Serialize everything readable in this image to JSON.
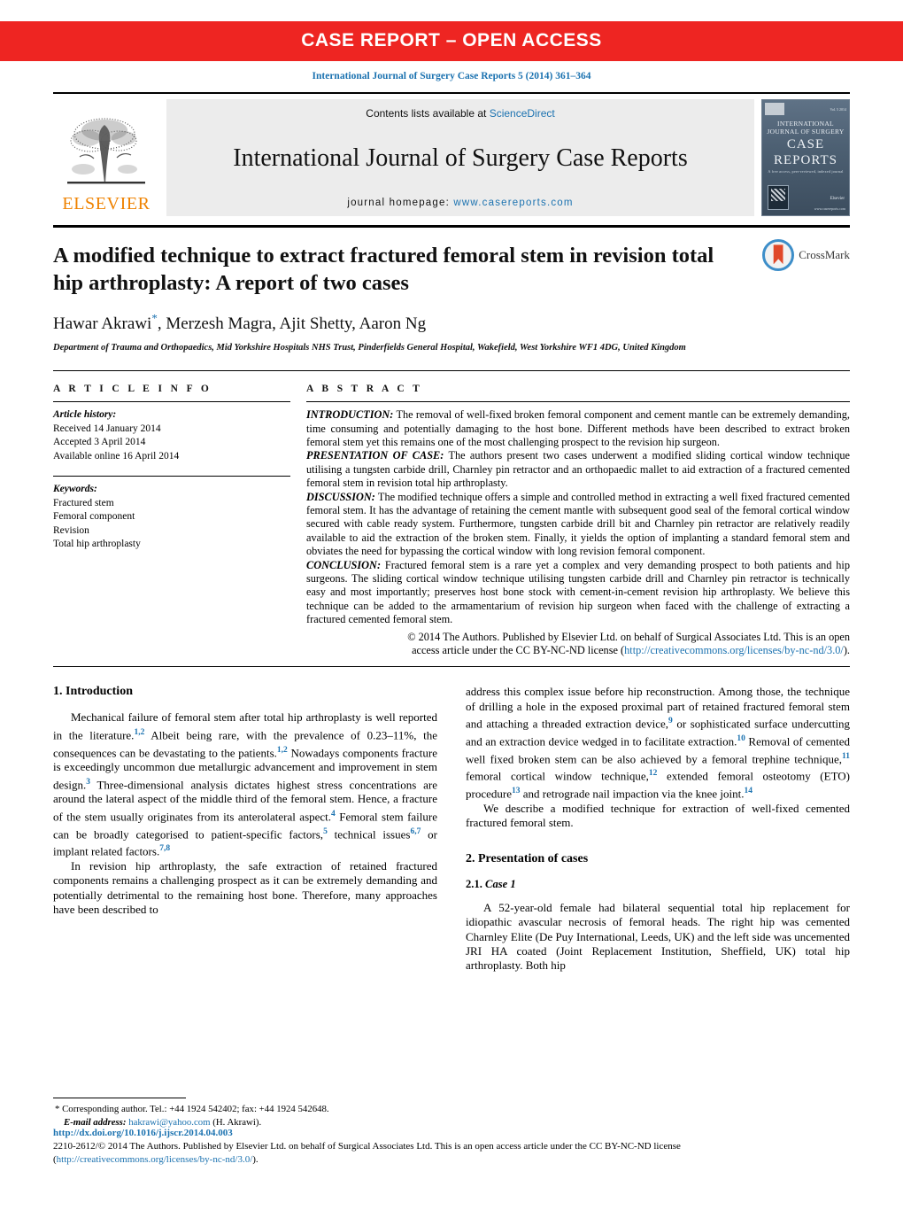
{
  "banner": {
    "text": "CASE REPORT – OPEN ACCESS"
  },
  "journal_ref": "International Journal of Surgery Case Reports 5 (2014) 361–364",
  "masthead": {
    "publisher_name": "ELSEVIER",
    "contents_prefix": "Contents lists available at ",
    "contents_link": "ScienceDirect",
    "journal_title": "International Journal of Surgery Case Reports",
    "homepage_prefix": "journal homepage: ",
    "homepage_url": "www.casereports.com",
    "cover": {
      "line1": "INTERNATIONAL JOURNAL OF SURGERY",
      "line2a": "CASE",
      "line2b": "REPORTS",
      "line3": "A free access, peer-reviewed, indexed journal",
      "brand": "Elsevier",
      "url": "www.casereports.com"
    }
  },
  "article": {
    "title": "A modified technique to extract fractured femoral stem in revision total hip arthroplasty: A report of two cases",
    "authors": "Hawar Akrawi, Merzesh Magra, Ajit Shetty, Aaron Ng",
    "corresponding_marker": "*",
    "affiliation": "Department of Trauma and Orthopaedics, Mid Yorkshire Hospitals NHS Trust, Pinderfields General Hospital, Wakefield, West Yorkshire WF1 4DG, United Kingdom",
    "crossmark_label": "CrossMark"
  },
  "article_info": {
    "heading": "A R T I C L E  I N F O",
    "history_label": "Article history:",
    "history": [
      "Received 14 January 2014",
      "Accepted 3 April 2014",
      "Available online 16 April 2014"
    ],
    "keywords_label": "Keywords:",
    "keywords": [
      "Fractured stem",
      "Femoral component",
      "Revision",
      "Total hip arthroplasty"
    ]
  },
  "abstract": {
    "heading": "A B S T R A C T",
    "sections": [
      {
        "label": "INTRODUCTION:",
        "text": " The removal of well-fixed broken femoral component and cement mantle can be extremely demanding, time consuming and potentially damaging to the host bone. Different methods have been described to extract broken femoral stem yet this remains one of the most challenging prospect to the revision hip surgeon."
      },
      {
        "label": "PRESENTATION OF CASE:",
        "text": " The authors present two cases underwent a modified sliding cortical window technique utilising a tungsten carbide drill, Charnley pin retractor and an orthopaedic mallet to aid extraction of a fractured cemented femoral stem in revision total hip arthroplasty."
      },
      {
        "label": "DISCUSSION:",
        "text": " The modified technique offers a simple and controlled method in extracting a well fixed fractured cemented femoral stem. It has the advantage of retaining the cement mantle with subsequent good seal of the femoral cortical window secured with cable ready system. Furthermore, tungsten carbide drill bit and Charnley pin retractor are relatively readily available to aid the extraction of the broken stem. Finally, it yields the option of implanting a standard femoral stem and obviates the need for bypassing the cortical window with long revision femoral component."
      },
      {
        "label": "CONCLUSION:",
        "text": " Fractured femoral stem is a rare yet a complex and very demanding prospect to both patients and hip surgeons. The sliding cortical window technique utilising tungsten carbide drill and Charnley pin retractor is technically easy and most importantly; preserves host bone stock with cement-in-cement revision hip arthroplasty. We believe this technique can be added to the armamentarium of revision hip surgeon when faced with the challenge of extracting a fractured cemented femoral stem."
      }
    ],
    "copyright_line1": "© 2014 The Authors. Published by Elsevier Ltd. on behalf of Surgical Associates Ltd. This is an open",
    "copyright_line2_prefix": "access article under the CC BY-NC-ND license (",
    "copyright_link": "http://creativecommons.org/licenses/by-nc-nd/3.0/",
    "copyright_line2_suffix": ")."
  },
  "body": {
    "left": {
      "section1_heading": "1.  Introduction",
      "para1_a": "Mechanical failure of femoral stem after total hip arthroplasty is well reported in the literature.",
      "para1_ref1": "1,2",
      "para1_b": " Albeit being rare, with the prevalence of 0.23–11%, the consequences can be devastating to the patients.",
      "para1_ref2": "1,2",
      "para1_c": " Nowadays components fracture is exceedingly uncommon due metallurgic advancement and improvement in stem design.",
      "para1_ref3": "3",
      "para1_d": " Three-dimensional analysis dictates highest stress concentrations are around the lateral aspect of the middle third of the femoral stem. Hence, a fracture of the stem usually originates from its anterolateral aspect.",
      "para1_ref4": "4",
      "para1_e": " Femoral stem failure can be broadly categorised to patient-specific factors,",
      "para1_ref5": "5",
      "para1_f": " technical issues",
      "para1_ref6": "6,7",
      "para1_g": " or implant related factors.",
      "para1_ref7": "7,8",
      "para2": "In revision hip arthroplasty, the safe extraction of retained fractured components remains a challenging prospect as it can be extremely demanding and potentially detrimental to the remaining host bone. Therefore, many approaches have been described to"
    },
    "right": {
      "para3_a": "address this complex issue before hip reconstruction. Among those, the technique of drilling a hole in the exposed proximal part of retained fractured femoral stem and attaching a threaded extraction device,",
      "para3_ref9": "9",
      "para3_b": " or sophisticated surface undercutting and an extraction device wedged in to facilitate extraction.",
      "para3_ref10": "10",
      "para3_c": " Removal of cemented well fixed broken stem can be also achieved by a femoral trephine technique,",
      "para3_ref11": "11",
      "para3_d": " femoral cortical window technique,",
      "para3_ref12": "12",
      "para3_e": " extended femoral osteotomy (ETO) procedure",
      "para3_ref13": "13",
      "para3_f": " and retrograde nail impaction via the knee joint.",
      "para3_ref14": "14",
      "para4": "We describe a modified technique for extraction of well-fixed cemented fractured femoral stem.",
      "section2_heading": "2.  Presentation of cases",
      "subsection_num": "2.1. ",
      "subsection_title": "Case 1",
      "para5": "A 52-year-old female had bilateral sequential total hip replacement for idiopathic avascular necrosis of femoral heads. The right hip was cemented Charnley Elite (De Puy International, Leeds, UK) and the left side was uncemented JRI HA coated (Joint Replacement Institution, Sheffield, UK) total hip arthroplasty. Both hip"
    }
  },
  "footnote": {
    "star": "*",
    "corresponding": " Corresponding author. Tel.: +44 1924 542402; fax: +44 1924 542648.",
    "email_label": "E-mail address:",
    "email": "hakrawi@yahoo.com",
    "email_suffix": " (H. Akrawi)."
  },
  "footer": {
    "doi": "http://dx.doi.org/10.1016/j.ijscr.2014.04.003",
    "line1": "2210-2612/© 2014 The Authors. Published by Elsevier Ltd. on behalf of Surgical Associates Ltd. This is an open access article under the CC BY-NC-ND license",
    "line2_open": "(",
    "line2_link": "http://creativecommons.org/licenses/by-nc-nd/3.0/",
    "line2_close": ")."
  },
  "colors": {
    "banner_red": "#ee2522",
    "link_blue": "#1b72b0",
    "elsevier_orange": "#ef8200",
    "masthead_gray": "#ececec"
  }
}
